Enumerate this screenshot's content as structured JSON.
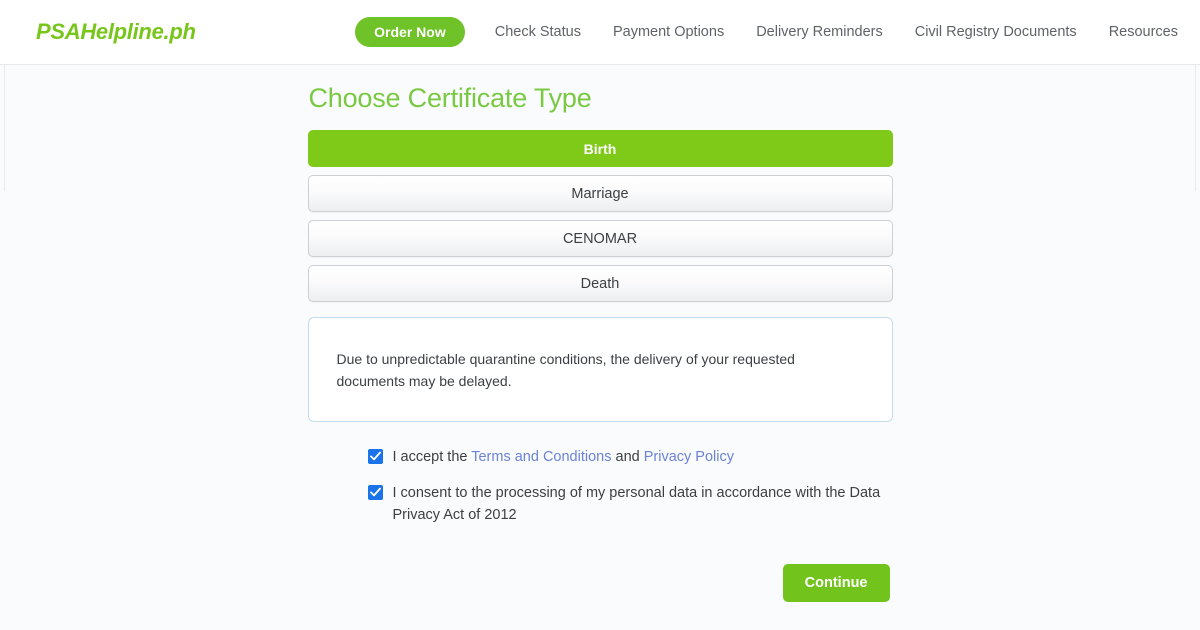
{
  "header": {
    "brand": "PSAHelpline.ph",
    "nav": [
      {
        "label": "Order Now",
        "style": "pill"
      },
      {
        "label": "Check Status",
        "style": "plain"
      },
      {
        "label": "Payment Options",
        "style": "plain"
      },
      {
        "label": "Delivery Reminders",
        "style": "plain"
      },
      {
        "label": "Civil Registry Documents",
        "style": "plain"
      },
      {
        "label": "Resources",
        "style": "plain"
      }
    ]
  },
  "main": {
    "title": "Choose Certificate Type",
    "certificate_types": [
      {
        "label": "Birth",
        "selected": true
      },
      {
        "label": "Marriage",
        "selected": false
      },
      {
        "label": "CENOMAR",
        "selected": false
      },
      {
        "label": "Death",
        "selected": false
      }
    ],
    "notice": "Due to unpredictable quarantine conditions, the delivery of your requested documents may be delayed.",
    "consents": [
      {
        "checked": true,
        "prefix": "I accept the ",
        "link1": "Terms and Conditions",
        "middle": " and ",
        "link2": "Privacy Policy",
        "suffix": ""
      },
      {
        "checked": true,
        "prefix": "I consent to the processing of my personal data in accordance with the Data Privacy Act of 2012",
        "link1": "",
        "middle": "",
        "link2": "",
        "suffix": ""
      }
    ],
    "continue_label": "Continue"
  },
  "colors": {
    "brand_green": "#78c51c",
    "title_green": "#7ac943",
    "active_button_green": "#7fc918",
    "continue_green": "#72c41c",
    "pill_green": "#6fc228",
    "checkbox_blue": "#1a73e8",
    "link_blue": "#6b83d6",
    "notice_border": "#c5dcf0",
    "page_background": "#fafbfc"
  }
}
